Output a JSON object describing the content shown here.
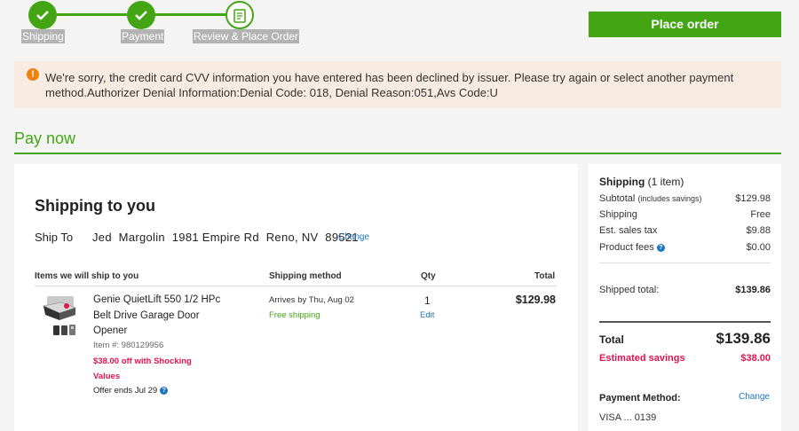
{
  "stepper": {
    "steps": [
      {
        "label": "Shipping",
        "state": "done"
      },
      {
        "label": "Payment",
        "state": "done"
      },
      {
        "label": "Review & Place Order",
        "state": "current"
      }
    ]
  },
  "header": {
    "place_order_label": "Place order"
  },
  "alert": {
    "icon": "alert-icon",
    "message": "We're sorry, the credit card CVV information you have entered has been declined by issuer. Please try again or select another payment method.Authorizer Denial Information:Denial Code: 018, Denial Reason:051,Avs Code:U"
  },
  "pay_now": {
    "title": "Pay now"
  },
  "shipping": {
    "title": "Shipping to you",
    "ship_to_label": "Ship To",
    "address": "Jed  Margolin  1981 Empire Rd  Reno, NV  89521",
    "change_label": "Change",
    "columns": [
      "Items we will ship to you",
      "Shipping method",
      "Qty",
      "Total"
    ],
    "item": {
      "name": "Genie QuietLift 550 1/2 HPc Belt Drive Garage Door Opener",
      "item_number": "Item #: 980129956",
      "promo": "$38.00 off with Shocking Values",
      "offer_ends": "Offer ends Jul 29",
      "arrives": "Arrives by Thu, Aug 02",
      "shipping_note": "Free shipping",
      "qty": "1",
      "edit_label": "Edit",
      "total": "$129.98"
    }
  },
  "summary": {
    "title": "Shipping",
    "title_count": "(1 item)",
    "subtotal_label": "Subtotal",
    "subtotal_note": "(includes savings)",
    "subtotal_value": "$129.98",
    "shipping_label": "Shipping",
    "shipping_value": "Free",
    "tax_label": "Est. sales tax",
    "tax_value": "$9.88",
    "fees_label": "Product fees",
    "fees_value": "$0.00",
    "shipped_total_label": "Shipped total:",
    "shipped_total_value": "$139.86",
    "total_label": "Total",
    "total_value": "$139.86",
    "savings_label": "Estimated savings",
    "savings_value": "$38.00",
    "payment_method_label": "Payment Method:",
    "payment_change_label": "Change",
    "payment_method_value": "VISA ... 0139"
  },
  "colors": {
    "brand_green": "#43a514",
    "savings_red": "#e3134f",
    "link_blue": "#1d74c2",
    "alert_bg": "#f8ebe2"
  }
}
